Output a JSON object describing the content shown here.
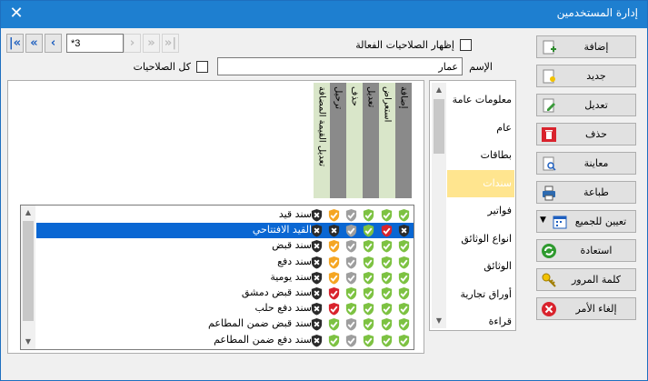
{
  "window": {
    "title": "إدارة المستخدمين",
    "close_label": "✕"
  },
  "navigator": {
    "first": "|«",
    "prev_page": "«",
    "prev": "‹",
    "record": "*3",
    "next": "›",
    "next_page": "»",
    "last": "»|"
  },
  "filters": {
    "show_active_label": "إظهار الصلاحيات الفعالة",
    "all_permissions_label": "كل الصلاحيات",
    "name_label": "الإسم",
    "name_value": "عمار"
  },
  "columns": [
    "إضافة",
    "استعراض",
    "تعديل",
    "حذف",
    "ترحيل",
    "تعديل القيمة المضافة"
  ],
  "rows": [
    {
      "name": "سند قيد",
      "perms": [
        "g",
        "g",
        "g",
        "s",
        "o",
        "b"
      ]
    },
    {
      "name": "القيد الافتتاحي",
      "perms": [
        "b",
        "r",
        "g",
        "s",
        "b",
        "b"
      ]
    },
    {
      "name": "سند قبض",
      "perms": [
        "g",
        "g",
        "g",
        "s",
        "o",
        "b"
      ]
    },
    {
      "name": "سند دفع",
      "perms": [
        "g",
        "g",
        "g",
        "s",
        "o",
        "b"
      ]
    },
    {
      "name": "سند يومية",
      "perms": [
        "g",
        "g",
        "g",
        "s",
        "o",
        "b"
      ]
    },
    {
      "name": "سند قبض دمشق",
      "perms": [
        "g",
        "g",
        "g",
        "g",
        "r",
        "b"
      ]
    },
    {
      "name": "سند دفع حلب",
      "perms": [
        "g",
        "g",
        "g",
        "g",
        "r",
        "b"
      ]
    },
    {
      "name": "سند قبض ضمن المطاعم",
      "perms": [
        "g",
        "g",
        "g",
        "s",
        "g",
        "b"
      ]
    },
    {
      "name": "سند دفع ضمن المطاعم",
      "perms": [
        "g",
        "g",
        "g",
        "s",
        "g",
        "b"
      ]
    }
  ],
  "sidebar": [
    "معلومات عامة",
    "عام",
    "بطاقات",
    "سندات",
    "فواتير",
    "انواع الوثائق",
    "الوثائق",
    "أوراق تجارية",
    "قراءة"
  ],
  "sidebar_active": "سندات",
  "buttons": {
    "add": "إضافة",
    "new": "جديد",
    "edit": "تعديل",
    "delete": "حذف",
    "preview": "معاينة",
    "print": "طباعة",
    "assign_all": "تعيين للجميع",
    "restore": "استعادة",
    "password": "كلمة المرور",
    "cancel": "إلغاء الأمر"
  },
  "colors": {
    "title_bar": "#1e7fd0",
    "selection": "#0a67d3",
    "active_tab": "#ffe58f",
    "allow": "#7dc242",
    "deny": "#d9232d",
    "blocked": "#2b2b2b",
    "inherited": "#f5a623",
    "neutral": "#9e9e9e"
  },
  "icons": {
    "g": "shield-check-green-icon",
    "r": "shield-check-red-icon",
    "b": "shield-x-black-icon",
    "o": "shield-check-orange-icon",
    "s": "shield-check-gray-icon"
  }
}
